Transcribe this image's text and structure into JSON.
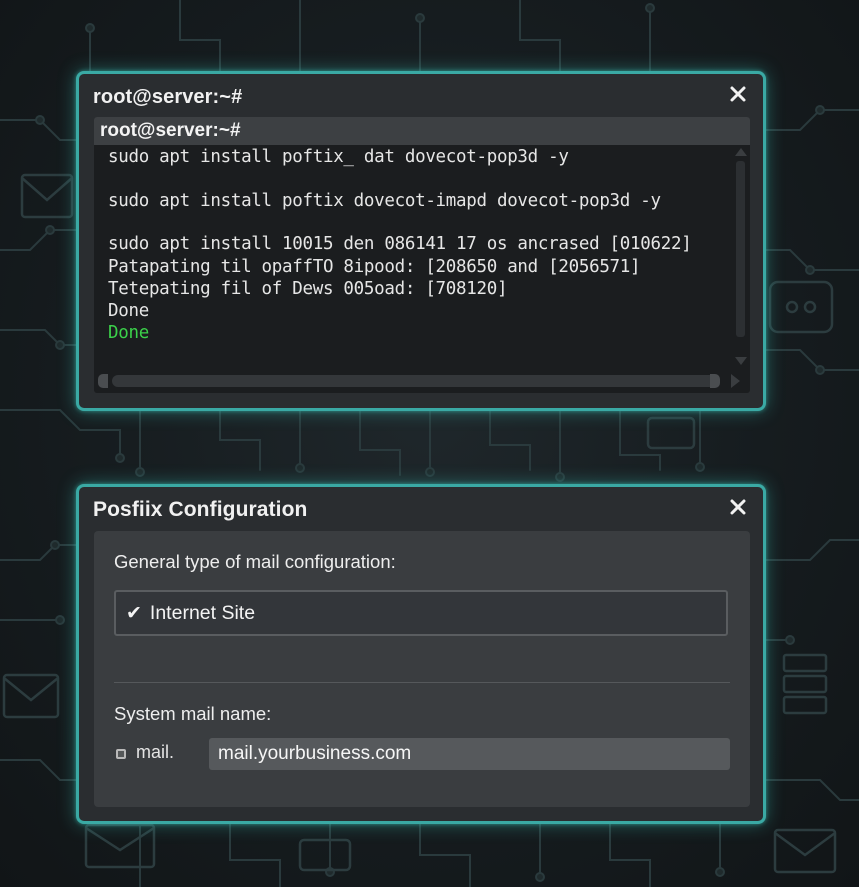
{
  "terminal": {
    "window_title": "root@server:~#",
    "prompt": "root@server:~#",
    "lines": [
      "sudo apt install poftix_ dat dovecot-pop3d -y",
      "sudo apt install poftix dovecot-imapd dovecot-pop3d -y",
      "sudo apt install 10015 den 086141 17 os ancrased [010622]",
      "Patapating til opaffTO 8ipood: [208650 and [2056571]",
      "Tetepating fil of Dews 005oad: [708120]",
      "Done",
      "Done"
    ],
    "close_glyph": "✕"
  },
  "config": {
    "window_title": "Posfiix Configuration",
    "mail_type_label": "General type of mail configuration:",
    "mail_type_value": "Internet Site",
    "check_glyph": "✔",
    "system_mail_label": "System mail name:",
    "prefix_label": "mail.",
    "system_mail_value": "mail.yourbusiness.com",
    "close_glyph": "✕"
  },
  "colors": {
    "accent_border": "#3aa9a4",
    "done_green": "#3bd14a",
    "window_bg": "#2a2d30",
    "terminal_bg": "#1b1d1f"
  },
  "icons": {
    "background": [
      "envelope-icon",
      "chat-bubble-icon",
      "server-rack-icon",
      "circuit-trace-icon"
    ]
  }
}
